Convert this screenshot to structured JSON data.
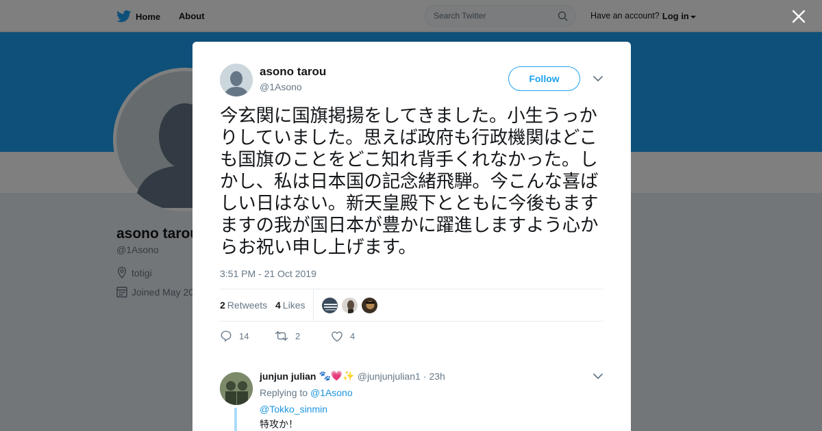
{
  "topbar": {
    "home_label": "Home",
    "about_label": "About",
    "search_placeholder": "Search Twitter",
    "have_account": "Have an account?",
    "login_label": "Log in"
  },
  "profile": {
    "name": "asono tarou",
    "handle": "@1Asono",
    "location": "totigi",
    "joined": "Joined May 20"
  },
  "tweet": {
    "author_name": "asono tarou",
    "author_handle": "@1Asono",
    "follow_label": "Follow",
    "text": "今玄関に国旗掲揚をしてきました。小生うっかりしていました。思えば政府も行政機関はどこも国旗のことをどこ知れ背手くれなかった。しかし、私は日本国の記念緒飛騨。今こんな喜ばしい日はない。新天皇殿下とともに今後もますますの我が国日本が豊かに躍進しますよう心からお祝い申し上げます。",
    "timestamp": "3:51 PM - 21 Oct 2019",
    "retweets_count": "2",
    "retweets_label": "Retweets",
    "likes_count": "4",
    "likes_label": "Likes",
    "reply_count": "14",
    "retweet_count": "2",
    "like_count": "4"
  },
  "reply": {
    "name": "junjun julian",
    "emoji": "🐾💗✨",
    "handle": "@junjunjulian1",
    "separator": "·",
    "time": "23h",
    "replying_to_label": "Replying to",
    "replying_to_handle": "@1Asono",
    "mention": "@Tokko_sinmin",
    "text": "特攻か！"
  },
  "colors": {
    "brand_blue": "#1da1f2",
    "link_blue": "#1b95e0",
    "text_primary": "#14171a",
    "text_secondary": "#657786",
    "overlay": "rgba(0,0,0,0.5)"
  }
}
